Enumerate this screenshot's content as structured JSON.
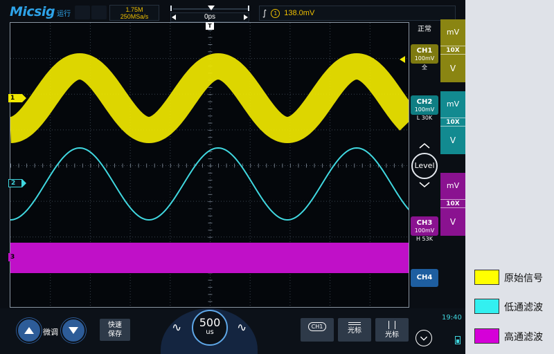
{
  "brand": {
    "name": "Micsig",
    "subtitle": "运行"
  },
  "acquisition": {
    "memory_depth": "1.75M",
    "sample_rate": "250MSa/s"
  },
  "horizontal": {
    "position": "0ps"
  },
  "trigger": {
    "edge_symbol": "∫",
    "source": "1",
    "level": "138.0mV",
    "mode": "正常"
  },
  "grid_marker": "T",
  "channels": [
    {
      "id": "1",
      "name": "CH1",
      "scale": "100mV",
      "mode": "全",
      "color": "#f0e800"
    },
    {
      "id": "2",
      "name": "CH2",
      "scale": "100mV",
      "mode": "L 30K",
      "color": "#40d8e0"
    },
    {
      "id": "3",
      "name": "CH3",
      "scale": "100mV",
      "mode": "H 53K",
      "color": "#c010c8"
    },
    {
      "id": "4",
      "name": "CH4"
    }
  ],
  "channel_controls": [
    {
      "unit": "mV",
      "probe": "10X",
      "down": "V"
    },
    {
      "unit": "mV",
      "probe": "10X",
      "down": "V"
    },
    {
      "unit": "mV",
      "probe": "10X",
      "down": "V"
    }
  ],
  "level_button": "Level",
  "bottom": {
    "fine_label": "微调",
    "save_label_1": "快速",
    "save_label_2": "保存",
    "timebase_value": "500",
    "timebase_unit": "us",
    "ch1_button": "CH1",
    "cursor_h_label": "光标",
    "cursor_v_label": "光标",
    "clock": "19:40"
  },
  "legend": [
    {
      "label": "原始信号",
      "color": "#ffff00"
    },
    {
      "label": "低通滤波",
      "color": "#33f0f0"
    },
    {
      "label": "高通滤波",
      "color": "#d500d8"
    }
  ]
}
